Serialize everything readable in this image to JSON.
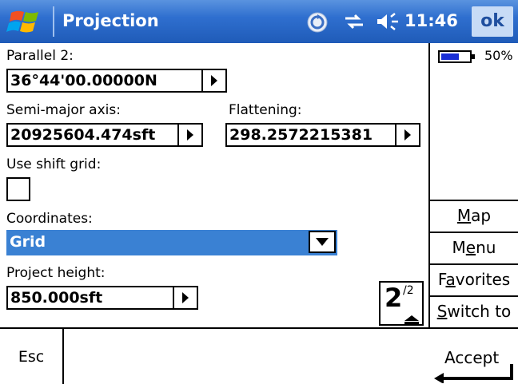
{
  "titlebar": {
    "title": "Projection",
    "time": "11:46",
    "ok_label": "ok",
    "accent": "#2f6fcf"
  },
  "form": {
    "parallel2": {
      "label": "Parallel 2:",
      "value": "36°44'00.00000N"
    },
    "semi_major": {
      "label": "Semi-major axis:",
      "value": "20925604.474sft"
    },
    "flattening": {
      "label": "Flattening:",
      "value": "298.2572215381"
    },
    "shift_grid": {
      "label": "Use shift grid:",
      "checked": false
    },
    "coordinates": {
      "label": "Coordinates:",
      "selected": "Grid",
      "highlight": "#3a81d3"
    },
    "project_height": {
      "label": "Project height:",
      "value": "850.000sft"
    },
    "page": {
      "current": "2",
      "total": "/2"
    }
  },
  "side": {
    "battery": "50%",
    "map": {
      "before": "",
      "accel": "M",
      "after": "ap"
    },
    "menu": {
      "before": "M",
      "accel": "e",
      "after": "nu"
    },
    "favorites": {
      "before": "F",
      "accel": "a",
      "after": "vorites"
    },
    "switch": {
      "before": "",
      "accel": "S",
      "after": "witch to"
    }
  },
  "bottom": {
    "esc": "Esc",
    "accept": "Accept"
  },
  "icons": [
    "windows-start-icon",
    "sync-icon",
    "connectivity-icon",
    "volume-icon",
    "battery-icon",
    "arrow-right-icon",
    "chevron-down-icon",
    "page-up-icon",
    "enter-icon"
  ]
}
